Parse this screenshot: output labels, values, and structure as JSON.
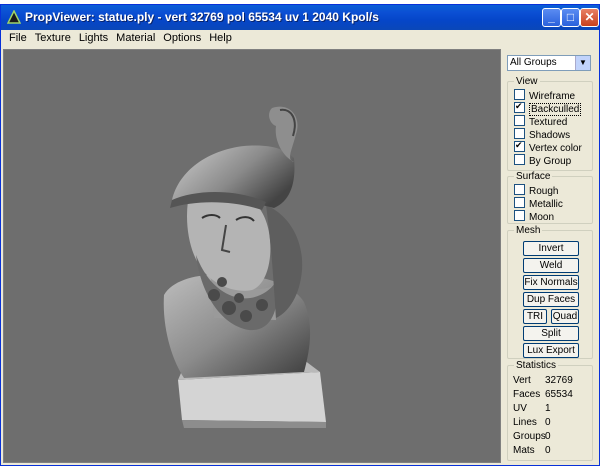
{
  "window": {
    "title": "PropViewer: statue.ply - vert 32769  pol 65534  uv 1   2040 Kpol/s",
    "minimize": "_",
    "maximize": "□",
    "close": "✕",
    "accent": "#0a5fd6"
  },
  "menu": [
    "File",
    "Texture",
    "Lights",
    "Material",
    "Options",
    "Help"
  ],
  "groups_select": {
    "value": "All Groups",
    "arrow": "▼"
  },
  "view": {
    "legend": "View",
    "items": [
      {
        "label": "Wireframe",
        "checked": false
      },
      {
        "label": "Backculled",
        "checked": true
      },
      {
        "label": "Textured",
        "checked": false
      },
      {
        "label": "Shadows",
        "checked": false
      },
      {
        "label": "Vertex color",
        "checked": true
      },
      {
        "label": "By Group",
        "checked": false
      }
    ]
  },
  "surface": {
    "legend": "Surface",
    "items": [
      {
        "label": "Rough",
        "checked": false
      },
      {
        "label": "Metallic",
        "checked": false
      },
      {
        "label": "Moon",
        "checked": false
      }
    ]
  },
  "mesh": {
    "legend": "Mesh",
    "invert": "Invert",
    "weld": "Weld",
    "fix_normals": "Fix Normals",
    "dup_faces": "Dup Faces",
    "tri": "TRI",
    "quad": "Quad",
    "split": "Split",
    "lux_export": "Lux Export"
  },
  "statistics": {
    "legend": "Statistics",
    "rows": [
      {
        "key": "Vert",
        "value": "32769"
      },
      {
        "key": "Faces",
        "value": "65534"
      },
      {
        "key": "UV",
        "value": "1"
      },
      {
        "key": "Lines",
        "value": "0"
      },
      {
        "key": "Groups",
        "value": "0"
      },
      {
        "key": "Mats",
        "value": "0"
      }
    ]
  }
}
